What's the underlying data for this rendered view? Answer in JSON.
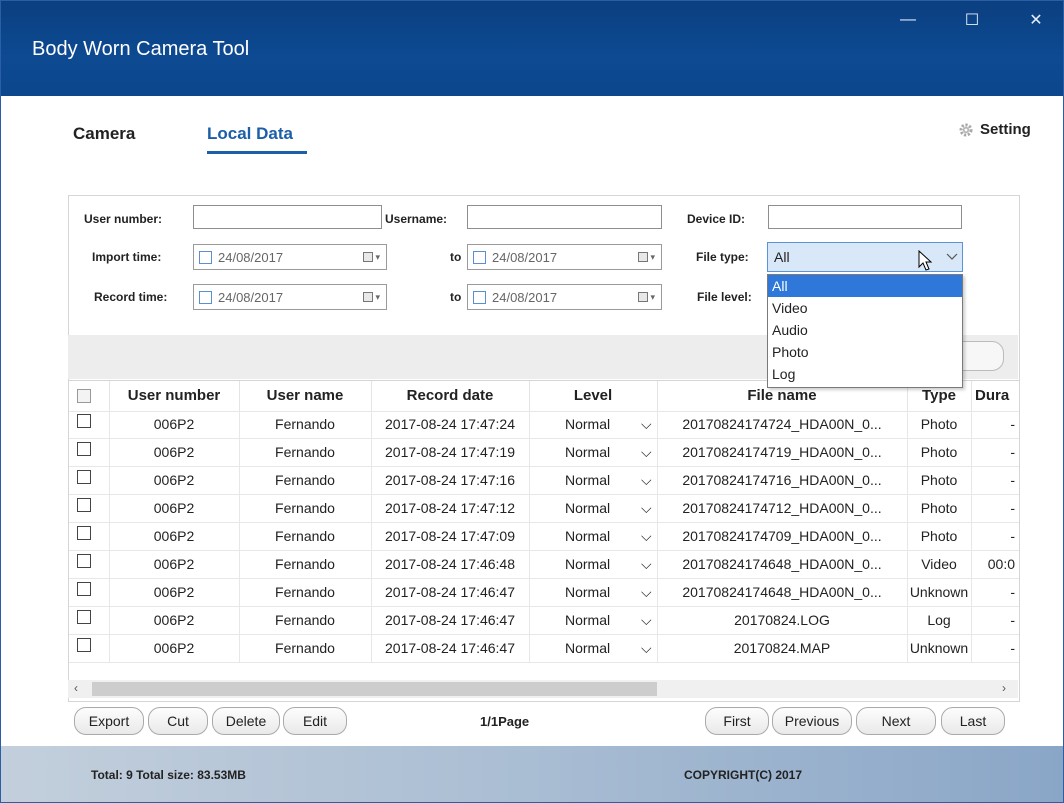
{
  "window": {
    "title": "Body Worn Camera Tool",
    "minimize": "—",
    "maximize": "☐",
    "close": "✕"
  },
  "tabs": [
    {
      "label": "Camera"
    },
    {
      "label": "Local Data"
    }
  ],
  "setting": {
    "label": "Setting"
  },
  "filter": {
    "user_number_label": "User number:",
    "username_label": "Username:",
    "device_id_label": "Device ID:",
    "import_time_label": "Import time:",
    "record_time_label": "Record time:",
    "to_label": "to",
    "file_type_label": "File type:",
    "file_level_label": "File level:",
    "import_from": "24/08/2017",
    "import_to": "24/08/2017",
    "record_from": "24/08/2017",
    "record_to": "24/08/2017",
    "file_type_value": "All",
    "file_type_options": [
      "All",
      "Video",
      "Audio",
      "Photo",
      "Log"
    ]
  },
  "table": {
    "columns": [
      "User number",
      "User name",
      "Record date",
      "Level",
      "File name",
      "Type",
      "Dura"
    ],
    "rows": [
      {
        "user": "006P2",
        "name": "Fernando",
        "date": "2017-08-24 17:47:24",
        "level": "Normal",
        "file": "20170824174724_HDA00N_0...",
        "type": "Photo",
        "dur": "-"
      },
      {
        "user": "006P2",
        "name": "Fernando",
        "date": "2017-08-24 17:47:19",
        "level": "Normal",
        "file": "20170824174719_HDA00N_0...",
        "type": "Photo",
        "dur": "-"
      },
      {
        "user": "006P2",
        "name": "Fernando",
        "date": "2017-08-24 17:47:16",
        "level": "Normal",
        "file": "20170824174716_HDA00N_0...",
        "type": "Photo",
        "dur": "-"
      },
      {
        "user": "006P2",
        "name": "Fernando",
        "date": "2017-08-24 17:47:12",
        "level": "Normal",
        "file": "20170824174712_HDA00N_0...",
        "type": "Photo",
        "dur": "-"
      },
      {
        "user": "006P2",
        "name": "Fernando",
        "date": "2017-08-24 17:47:09",
        "level": "Normal",
        "file": "20170824174709_HDA00N_0...",
        "type": "Photo",
        "dur": "-"
      },
      {
        "user": "006P2",
        "name": "Fernando",
        "date": "2017-08-24 17:46:48",
        "level": "Normal",
        "file": "20170824174648_HDA00N_0...",
        "type": "Video",
        "dur": "00:0"
      },
      {
        "user": "006P2",
        "name": "Fernando",
        "date": "2017-08-24 17:46:47",
        "level": "Normal",
        "file": "20170824174648_HDA00N_0...",
        "type": "Unknown",
        "dur": "-"
      },
      {
        "user": "006P2",
        "name": "Fernando",
        "date": "2017-08-24 17:46:47",
        "level": "Normal",
        "file": "20170824.LOG",
        "type": "Log",
        "dur": "-"
      },
      {
        "user": "006P2",
        "name": "Fernando",
        "date": "2017-08-24 17:46:47",
        "level": "Normal",
        "file": "20170824.MAP",
        "type": "Unknown",
        "dur": "-"
      }
    ]
  },
  "buttons": {
    "export": "Export",
    "cut": "Cut",
    "delete": "Delete",
    "edit": "Edit",
    "first": "First",
    "previous": "Previous",
    "next": "Next",
    "last": "Last"
  },
  "pagination": {
    "page_info": "1/1Page"
  },
  "status": {
    "summary": "Total: 9 Total size: 83.53MB",
    "copyright": "COPYRIGHT(C) 2017"
  },
  "colors": {
    "titlebar": "#0d4a92",
    "accent": "#1c5ea8",
    "selected_option": "#2f77d9"
  }
}
